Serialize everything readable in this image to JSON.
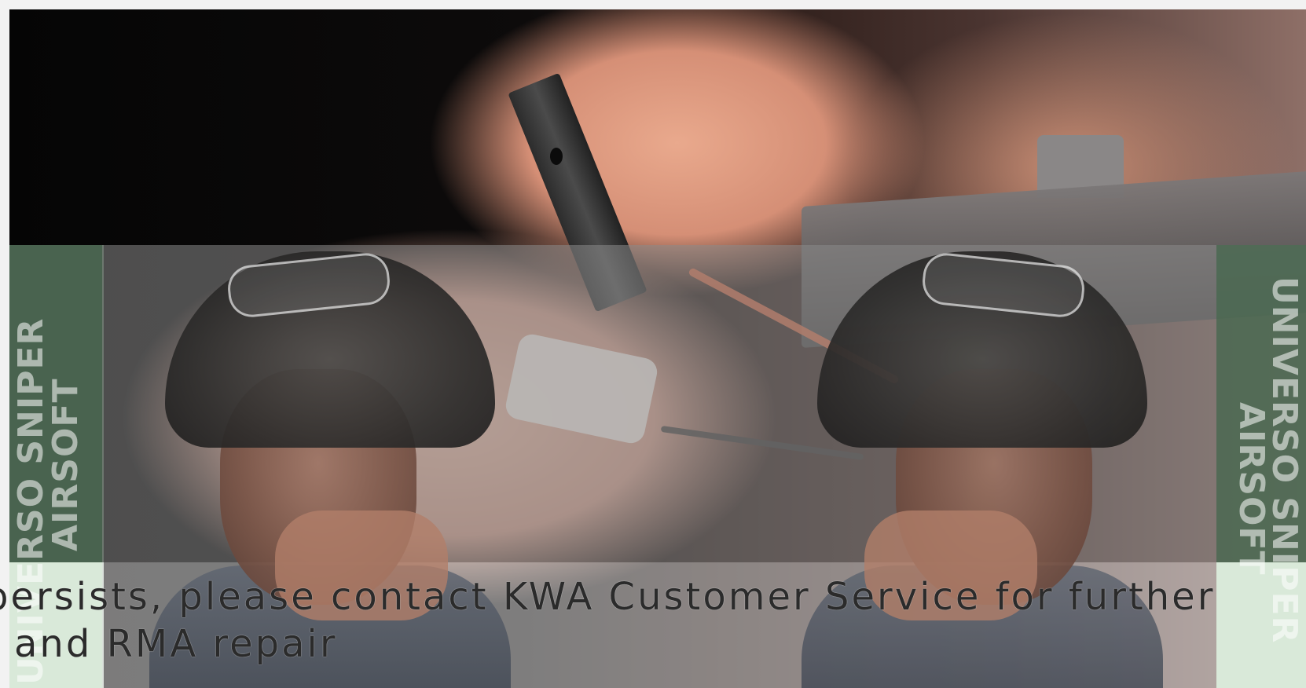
{
  "side_text": {
    "left_line1": "UNIVERSO SNIPER",
    "left_line2": "AIRSOFT",
    "right_line1": "UNIVERSO SNIPER",
    "right_line2": "AIRSOFT"
  },
  "message": {
    "line1": "persists, please contact KWA Customer Service for further",
    "line2": "and RMA repair"
  },
  "colors": {
    "strip_green": "#4f6b56",
    "strip_light": "#d9e9d9",
    "banner_grey": "#8a8a8a"
  }
}
